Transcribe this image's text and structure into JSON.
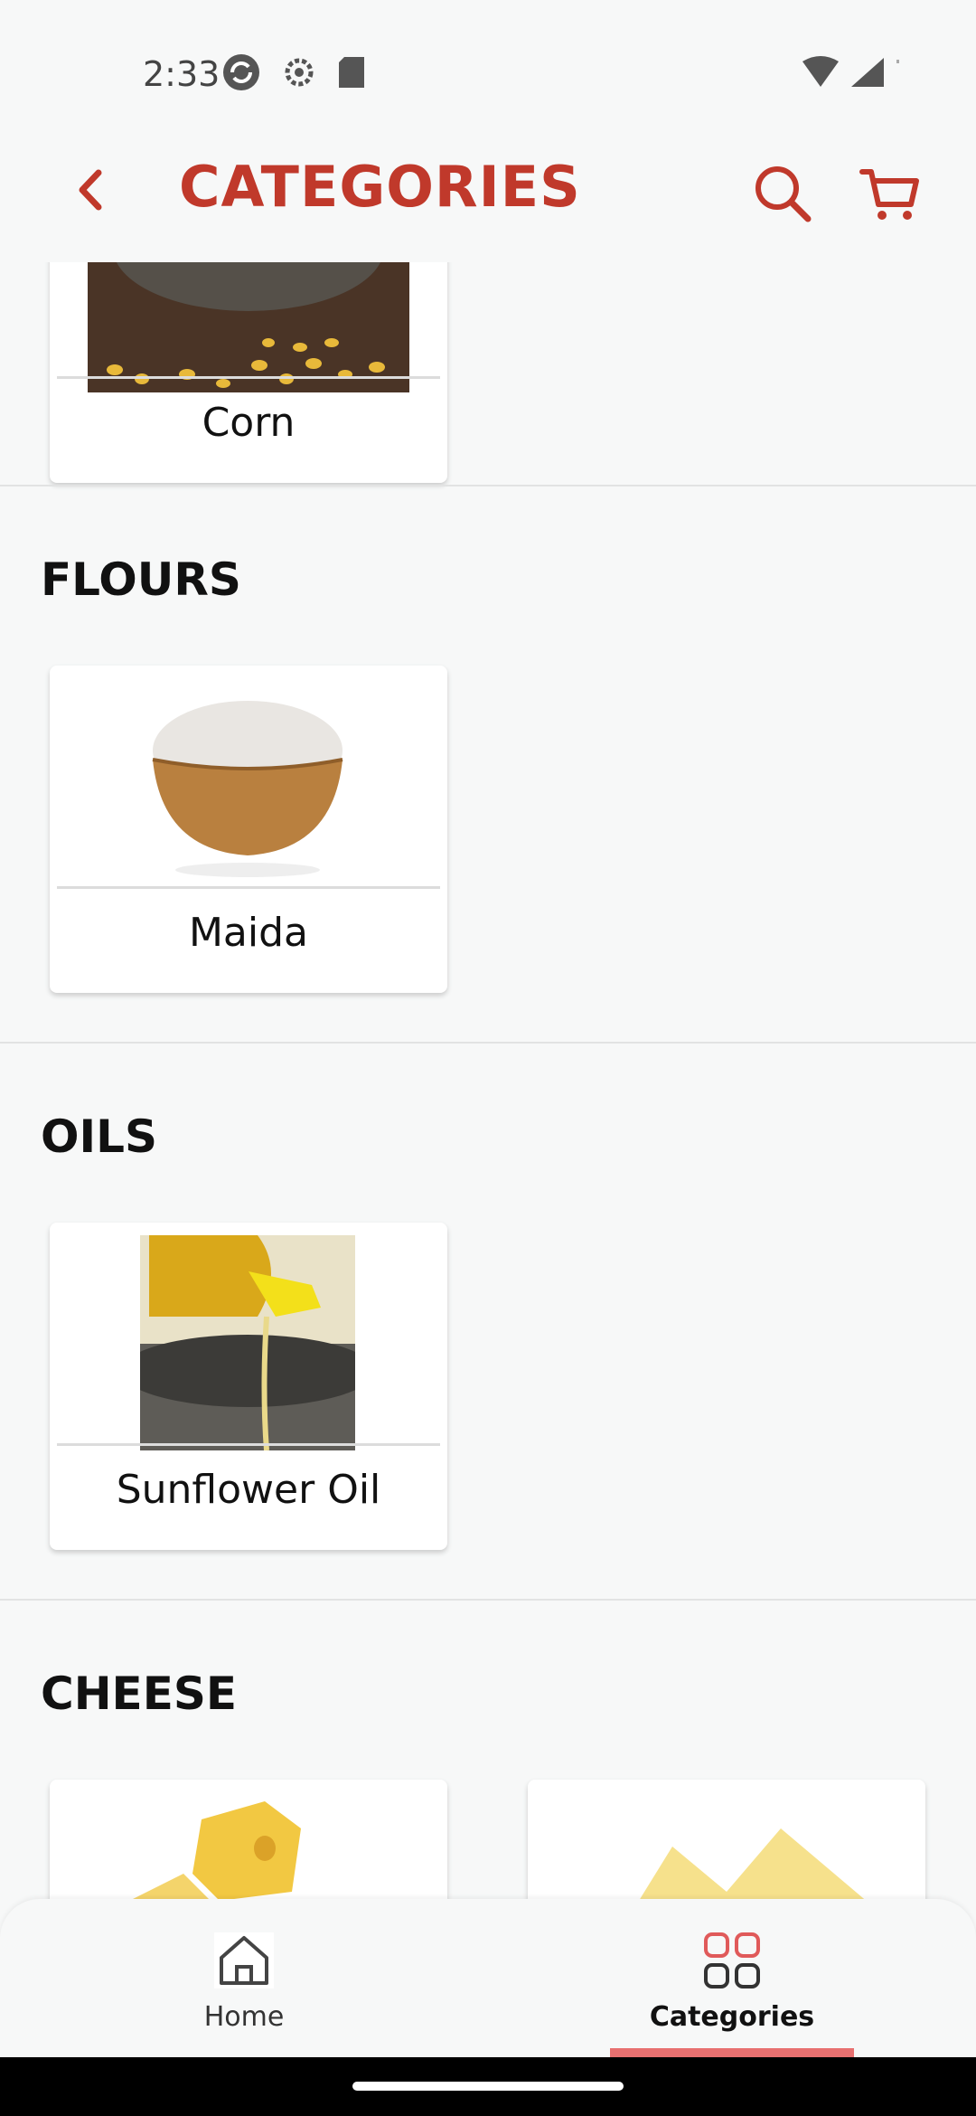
{
  "status_bar": {
    "time": "2:33"
  },
  "app_bar": {
    "title": "CATEGORIES"
  },
  "sections": [
    {
      "title": "",
      "items": [
        {
          "label": "Corn"
        }
      ]
    },
    {
      "title": "FLOURS",
      "items": [
        {
          "label": "Maida"
        }
      ]
    },
    {
      "title": "OILS",
      "items": [
        {
          "label": "Sunflower Oil"
        }
      ]
    },
    {
      "title": "CHEESE",
      "items": [
        {
          "label": ""
        },
        {
          "label": ""
        }
      ]
    }
  ],
  "bottom_nav": {
    "items": [
      {
        "label": "Home",
        "icon": "home-icon"
      },
      {
        "label": "Categories",
        "icon": "grid-icon",
        "active": true
      }
    ]
  },
  "colors": {
    "accent": "#c0392b",
    "indicator": "#e87070"
  }
}
